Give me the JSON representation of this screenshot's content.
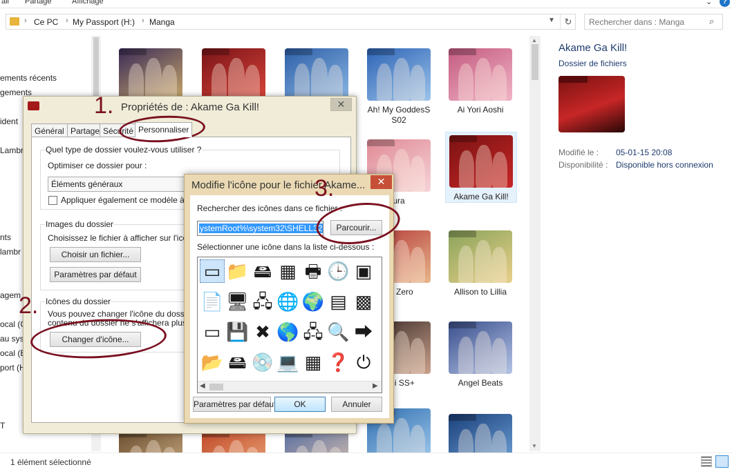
{
  "ribbon": {
    "tab_left": "ail",
    "partage": "Partage",
    "affichage": "Affichage"
  },
  "address": {
    "parts": [
      "Ce PC",
      "My Passport (H:)",
      "Manga"
    ]
  },
  "search": {
    "placeholder": "Rechercher dans : Manga"
  },
  "nav_items": [
    "ements récents",
    "gements",
    "ident",
    "Lambr",
    "nts",
    "lambr",
    "agem",
    "ocal (C",
    "au syst",
    "ocal (E",
    "port (H",
    "T"
  ],
  "thumbnails": [
    {
      "label": "",
      "art": [
        "#3a2b58",
        "#c9a86a"
      ]
    },
    {
      "label": "",
      "art": [
        "#7a1418",
        "#d9443a"
      ]
    },
    {
      "label": "",
      "art": [
        "#2d5fa8",
        "#8bb7e4"
      ]
    },
    {
      "label": "Ah! My GoddesS S02",
      "art": [
        "#2c63b5",
        "#9cc3ea"
      ]
    },
    {
      "label": "Ai Yori Aoshi",
      "art": [
        "#c45a80",
        "#f0b4c6"
      ]
    },
    {
      "label": "ura",
      "art": [
        "#e08a95",
        "#f5d3d8"
      ]
    },
    {
      "label": "Akame Ga Kill!",
      "art": [
        "#7a1212",
        "#c72626"
      ]
    },
    {
      "label": "ah Zero",
      "art": [
        "#b53a3a",
        "#e7b58a"
      ]
    },
    {
      "label": "Allison to Lillia",
      "art": [
        "#8aa35a",
        "#e8d08a"
      ]
    },
    {
      "label": "ami SS+",
      "art": [
        "#3b2d2a",
        "#caa08a"
      ]
    },
    {
      "label": "Angel Beats",
      "art": [
        "#3a4f8c",
        "#b3c3e6"
      ]
    },
    {
      "label": "",
      "art": [
        "#6a4f30",
        "#d4b48a"
      ]
    },
    {
      "label": "",
      "art": [
        "#c04a2a",
        "#f0b080"
      ]
    },
    {
      "label": "",
      "art": [
        "#5a6fa0",
        "#e6c9b0"
      ]
    },
    {
      "label": "",
      "art": [
        "#2f6fb0",
        "#a0c8ec"
      ]
    },
    {
      "label": "",
      "art": [
        "#1a3f7a",
        "#6fa3d8"
      ]
    }
  ],
  "details": {
    "name": "Akame Ga Kill!",
    "type": "Dossier de fichiers",
    "modified_label": "Modifié le :",
    "modified_value": "05-01-15 20:08",
    "availability_label": "Disponibilité :",
    "availability_value": "Disponible hors connexion"
  },
  "status": {
    "text": "1 élément sélectionné"
  },
  "props_dialog": {
    "title": "Propriétés de : Akame Ga Kill!",
    "tabs": [
      "Général",
      "Partage",
      "Sécurité",
      "Personnaliser"
    ],
    "q_label": "Quel type de dossier voulez-vous utiliser ?",
    "optimize_label": "Optimiser ce dossier pour :",
    "optimize_value": "Éléments généraux",
    "apply_checkbox": "Appliquer également ce modèle à tous",
    "images_label": "Images du dossier",
    "images_desc": "Choisissez le fichier à afficher sur l'icône d",
    "choose_file_btn": "Choisir un fichier...",
    "default_btn": "Paramètres par défaut",
    "icons_label": "Icônes du dossier",
    "icons_desc1": "Vous pouvez changer l'icône du dossier. S",
    "icons_desc2": "contenu du dossier ne s'affichera plus.",
    "change_icon_btn": "Changer d'icône..."
  },
  "icon_dialog": {
    "title": "Modifie l'icône pour le fichier Akame...",
    "search_label": "Rechercher des icônes dans ce fichier :",
    "path_value": "ystemRoot%\\system32\\SHELL32.dll",
    "browse_btn": "Parcourir...",
    "select_label": "Sélectionner une icône dans la liste ci-dessous :",
    "default_btn": "Paramètres par défaut",
    "ok_btn": "OK",
    "cancel_btn": "Annuler",
    "icons": [
      [
        "blank-window-icon",
        "folder-icon",
        "drive-icon",
        "chip-icon",
        "printer-icon",
        "clock-icon",
        "window-icon"
      ],
      [
        "document-icon",
        "monitor-drive-icon",
        "network-drive-icon",
        "globe-icon",
        "world-network-icon",
        "control-panel-icon",
        "shell-icon"
      ],
      [
        "window-app-icon",
        "floppy-icon",
        "delete-drive-icon",
        "globe-mouse-icon",
        "network-icon",
        "magnifier-icon",
        "arrow-drive-icon"
      ],
      [
        "open-folder-icon",
        "disk-drive-icon",
        "cd-drive-icon",
        "computer-icon",
        "calculator-icon",
        "help-icon",
        "power-icon"
      ]
    ],
    "glyphs": {
      "blank-window-icon": "▭",
      "folder-icon": "📁",
      "drive-icon": "🖴",
      "chip-icon": "▦",
      "printer-icon": "🖶",
      "clock-icon": "🕒",
      "window-icon": "▣",
      "document-icon": "📄",
      "monitor-drive-icon": "🖥",
      "network-drive-icon": "🖧",
      "globe-icon": "🌐",
      "world-network-icon": "🌍",
      "control-panel-icon": "▤",
      "shell-icon": "▩",
      "window-app-icon": "▭",
      "floppy-icon": "💾",
      "delete-drive-icon": "✖",
      "globe-mouse-icon": "🌎",
      "network-icon": "🖧",
      "magnifier-icon": "🔍",
      "arrow-drive-icon": "⮕",
      "open-folder-icon": "📂",
      "disk-drive-icon": "🖴",
      "cd-drive-icon": "💿",
      "computer-icon": "💻",
      "calculator-icon": "▦",
      "help-icon": "❓",
      "power-icon": "⏻"
    }
  },
  "annotations": {
    "step1": "1.",
    "step2": "2.",
    "step3": "3."
  }
}
